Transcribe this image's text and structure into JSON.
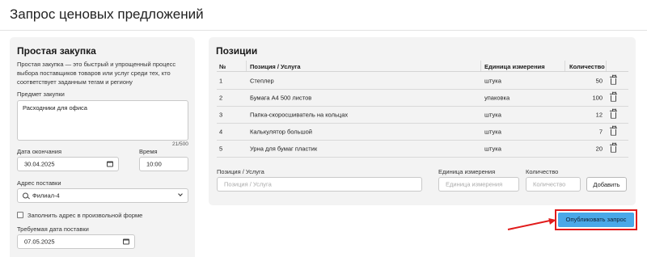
{
  "header": {
    "title": "Запрос ценовых предложений"
  },
  "form": {
    "title": "Простая закупка",
    "description": "Простая закупка — это быстрый и упрощенный процесс выбора поставщиков товаров или услуг среди тех, кто соответствует заданным тегам и региону",
    "subject_label": "Предмет закупки",
    "subject_value": "Расходники для офиса",
    "char_counter": "21/500",
    "end_date_label": "Дата окончания",
    "end_date_value": "30.04.2025",
    "time_label": "Время",
    "time_value": "10:00",
    "address_label": "Адрес поставки",
    "address_value": "Филиал-4",
    "free_address_label": "Заполнить адрес в произвольной форме",
    "delivery_date_label": "Требуемая дата поставки",
    "delivery_date_value": "07.05.2025"
  },
  "positions": {
    "title": "Позиции",
    "columns": [
      "№",
      "Позиция / Услуга",
      "Единица измерения",
      "Количество"
    ],
    "rows": [
      {
        "num": "1",
        "name": "Степлер",
        "unit": "штука",
        "qty": "50"
      },
      {
        "num": "2",
        "name": "Бумага А4 500 листов",
        "unit": "упаковка",
        "qty": "100"
      },
      {
        "num": "3",
        "name": "Папка-скоросшиватель на кольцах",
        "unit": "штука",
        "qty": "12"
      },
      {
        "num": "4",
        "name": "Калькулятор большой",
        "unit": "штука",
        "qty": "7"
      },
      {
        "num": "5",
        "name": "Урна для бумаг пластик",
        "unit": "штука",
        "qty": "20"
      }
    ],
    "new_item": {
      "name_label": "Позиция / Услуга",
      "name_placeholder": "Позиция / Услуга",
      "unit_label": "Единица измерения",
      "unit_placeholder": "Единица измерения",
      "qty_label": "Количество",
      "qty_placeholder": "Количество",
      "add_label": "Добавить"
    }
  },
  "publish": {
    "label": "Опубликовать запрос",
    "color": "#4aa8e8"
  },
  "annotation": {
    "color": "#e11b1b"
  }
}
